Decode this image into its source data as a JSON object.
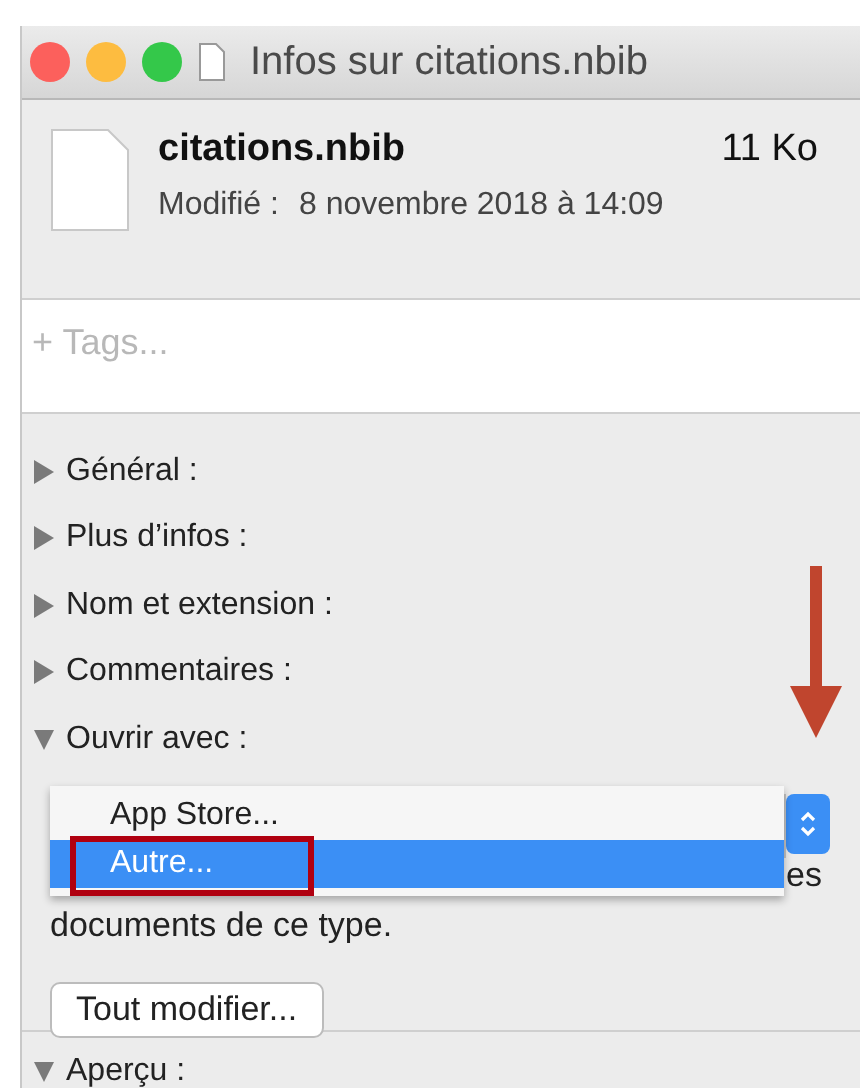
{
  "window": {
    "title": "Infos sur citations.nbib"
  },
  "file": {
    "name": "citations.nbib",
    "size": "11 Ko",
    "modified_label": "Modifié :",
    "modified_value": "8 novembre 2018 à 14:09"
  },
  "tags": {
    "placeholder": "+ Tags..."
  },
  "sections": [
    {
      "label": "Général :",
      "expanded": false
    },
    {
      "label": "Plus d’infos :",
      "expanded": false
    },
    {
      "label": "Nom et extension :",
      "expanded": false
    },
    {
      "label": "Commentaires :",
      "expanded": false
    },
    {
      "label": "Ouvrir avec :",
      "expanded": true
    }
  ],
  "open_with": {
    "menu": [
      {
        "label": "App Store...",
        "selected": false
      },
      {
        "label": "Autre...",
        "selected": true
      }
    ],
    "description_end": "es",
    "description_line2": "documents de ce type.",
    "button": "Tout modifier..."
  },
  "last_section": {
    "label": "Aperçu :",
    "expanded": true
  }
}
